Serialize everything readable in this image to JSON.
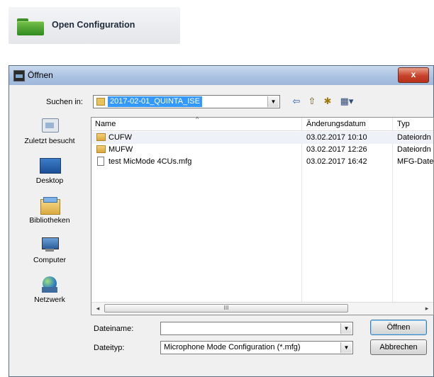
{
  "open_config": {
    "label": "Open Configuration"
  },
  "dialog": {
    "title": "Öffnen",
    "close_glyph": "x",
    "look_in": {
      "label": "Suchen in:",
      "value": "2017-02-01_QUINTA_ISE"
    },
    "toolbar": {
      "back": "⇦",
      "up": "⇧",
      "new_folder": "✱",
      "views": "▦▾"
    },
    "places": [
      {
        "label": "Zuletzt besucht",
        "icon": "recent-places-icon"
      },
      {
        "label": "Desktop",
        "icon": "desktop-icon"
      },
      {
        "label": "Bibliotheken",
        "icon": "libraries-icon"
      },
      {
        "label": "Computer",
        "icon": "computer-icon"
      },
      {
        "label": "Netzwerk",
        "icon": "network-icon"
      }
    ],
    "columns": {
      "name": "Name",
      "date": "Änderungsdatum",
      "type": "Typ"
    },
    "files": [
      {
        "name": "CUFW",
        "date": "03.02.2017 10:10",
        "type": "Dateiordn",
        "kind": "folder"
      },
      {
        "name": "MUFW",
        "date": "03.02.2017 12:26",
        "type": "Dateiordn",
        "kind": "folder"
      },
      {
        "name": "test MicMode 4CUs.mfg",
        "date": "03.02.2017 16:42",
        "type": "MFG-Date",
        "kind": "file"
      }
    ],
    "scroll": {
      "left": "◂",
      "right": "▸",
      "grip": "III"
    },
    "filename": {
      "label": "Dateiname:",
      "value": ""
    },
    "filetype": {
      "label": "Dateityp:",
      "value": "Microphone Mode Configuration (*.mfg)"
    },
    "buttons": {
      "open": "Öffnen",
      "cancel": "Abbrechen"
    }
  }
}
